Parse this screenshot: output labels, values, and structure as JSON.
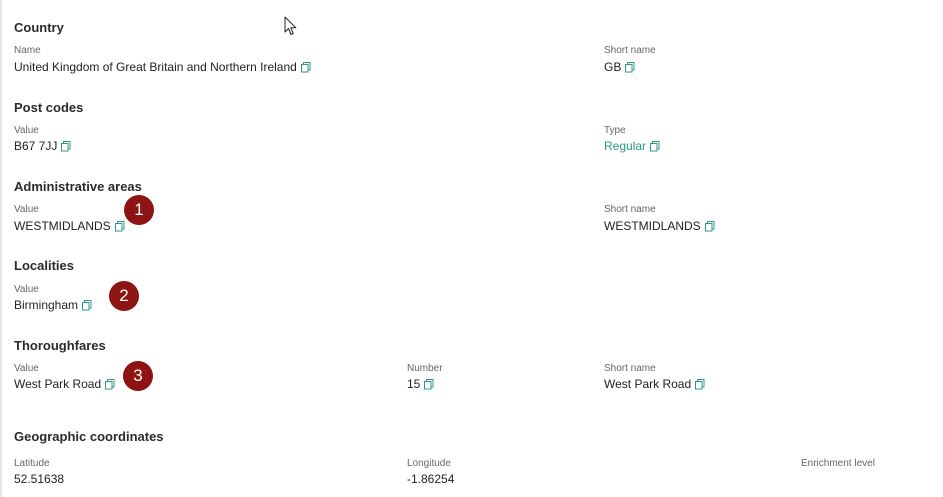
{
  "sections": {
    "country": {
      "title": "Country",
      "name_label": "Name",
      "name_value": "United Kingdom of Great Britain and Northern Ireland",
      "short_label": "Short name",
      "short_value": "GB"
    },
    "postcodes": {
      "title": "Post codes",
      "value_label": "Value",
      "value": "B67 7JJ",
      "type_label": "Type",
      "type_value": "Regular"
    },
    "admin": {
      "title": "Administrative areas",
      "value_label": "Value",
      "value": "WESTMIDLANDS",
      "short_label": "Short name",
      "short_value": "WESTMIDLANDS"
    },
    "localities": {
      "title": "Localities",
      "value_label": "Value",
      "value": "Birmingham"
    },
    "thoroughfares": {
      "title": "Thoroughfares",
      "value_label": "Value",
      "value": "West Park Road",
      "number_label": "Number",
      "number_value": "15",
      "short_label": "Short name",
      "short_value": "West Park Road"
    },
    "geo": {
      "title": "Geographic coordinates",
      "lat_label": "Latitude",
      "lat_value": "52.51638",
      "lon_label": "Longitude",
      "lon_value": "-1.86254",
      "enrich_label": "Enrichment level"
    }
  },
  "badges": [
    "1",
    "2",
    "3"
  ],
  "icons": {
    "copy": "copy-icon",
    "cursor": "mouse-pointer-icon"
  },
  "colors": {
    "accent": "#2e9a86",
    "badge": "#8e1414"
  }
}
